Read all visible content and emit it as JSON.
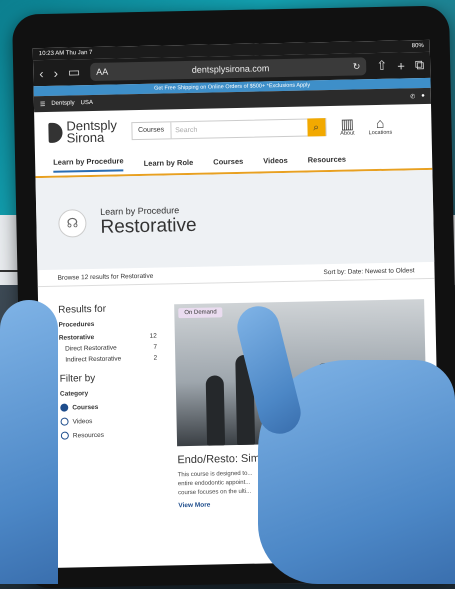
{
  "status_bar": {
    "time": "10:23 AM  Thu Jan 7",
    "battery": "80%"
  },
  "browser": {
    "text_size": "AA",
    "url": "dentsplysirona.com"
  },
  "promo": "Get Free Shipping on Online Orders of $500+ *Exclusions Apply",
  "topnav": {
    "region": "USA",
    "brand_small_1": "Dentsply",
    "brand_small_2": "Sirona"
  },
  "header": {
    "brand_1": "Dentsply",
    "brand_2": "Sirona",
    "search_category": "Courses",
    "search_placeholder": "Search",
    "about": "About",
    "locations": "Locations"
  },
  "main_nav": [
    "Learn by Procedure",
    "Learn by Role",
    "Courses",
    "Videos",
    "Resources"
  ],
  "hero": {
    "subtitle": "Learn by Procedure",
    "title": "Restorative"
  },
  "results_bar": {
    "left": "Browse 12 results for  Restorative",
    "right": "Sort by: Date: Newest to Oldest"
  },
  "sidebar": {
    "results_for": "Results for",
    "procedures": "Procedures",
    "items": [
      {
        "label": "Restorative",
        "count": "12"
      },
      {
        "label": "Direct Restorative",
        "count": "7"
      },
      {
        "label": "Indirect Restorative",
        "count": "2"
      }
    ],
    "filter_by": "Filter by",
    "category": "Category",
    "options": [
      "Courses",
      "Videos",
      "Resources"
    ]
  },
  "card": {
    "tag": "On Demand",
    "title": "Endo/Resto: Sim... Juggernaut to Ac...",
    "desc_1": "This course is designed to...",
    "desc_2": "entire endodontic appoint...",
    "desc_3": "course focuses on the ulti...",
    "more": "View More"
  },
  "colors": {
    "accent": "#f2a900",
    "link": "#1e4d8c",
    "promo": "#3e8fc9",
    "glove": "#5b95d3"
  }
}
